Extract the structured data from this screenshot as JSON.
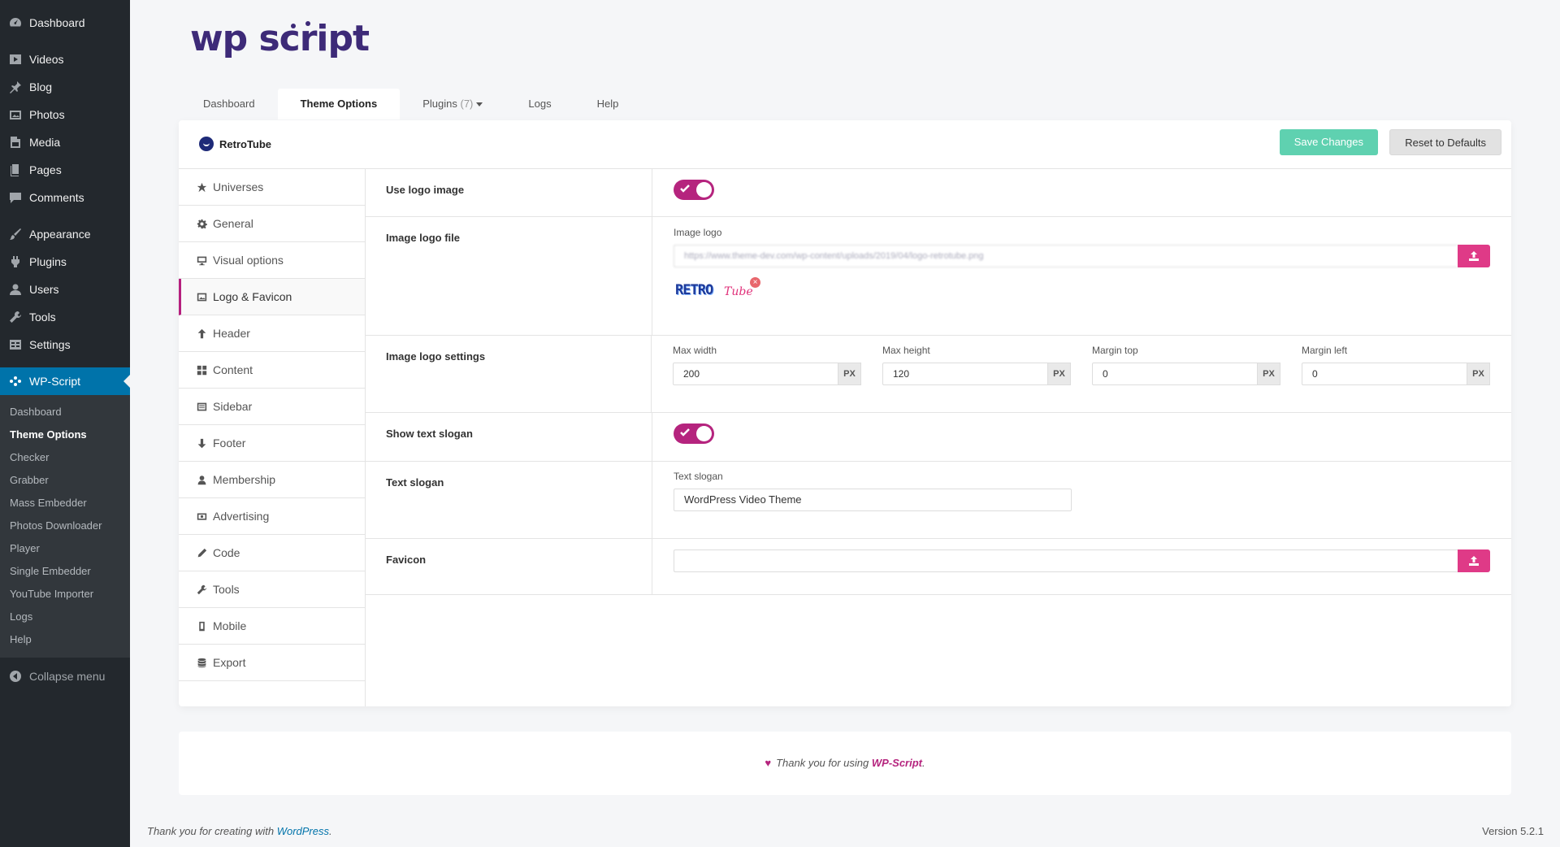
{
  "sidebar": {
    "items": [
      {
        "label": "Dashboard",
        "icon": "dashboard-icon"
      },
      {
        "label": "Videos",
        "icon": "video-icon"
      },
      {
        "label": "Blog",
        "icon": "pin-icon"
      },
      {
        "label": "Photos",
        "icon": "photos-icon"
      },
      {
        "label": "Media",
        "icon": "media-icon"
      },
      {
        "label": "Pages",
        "icon": "pages-icon"
      },
      {
        "label": "Comments",
        "icon": "comments-icon"
      },
      {
        "label": "Appearance",
        "icon": "brush-icon"
      },
      {
        "label": "Plugins",
        "icon": "plugin-icon"
      },
      {
        "label": "Users",
        "icon": "user-icon"
      },
      {
        "label": "Tools",
        "icon": "wrench-icon"
      },
      {
        "label": "Settings",
        "icon": "settings-icon"
      },
      {
        "label": "WP-Script",
        "icon": "wpscript-icon"
      }
    ],
    "submenu": [
      "Dashboard",
      "Theme Options",
      "Checker",
      "Grabber",
      "Mass Embedder",
      "Photos Downloader",
      "Player",
      "Single Embedder",
      "YouTube Importer",
      "Logs",
      "Help"
    ],
    "collapse": "Collapse menu"
  },
  "logo": "wp script",
  "tabs": [
    {
      "label": "Dashboard"
    },
    {
      "label": "Theme Options"
    },
    {
      "label": "Plugins",
      "count": "(7)"
    },
    {
      "label": "Logs"
    },
    {
      "label": "Help"
    }
  ],
  "panel": {
    "brand": "RetroTube",
    "save": "Save Changes",
    "reset": "Reset to Defaults"
  },
  "leftnav": [
    "Universes",
    "General",
    "Visual options",
    "Logo & Favicon",
    "Header",
    "Content",
    "Sidebar",
    "Footer",
    "Membership",
    "Advertising",
    "Code",
    "Tools",
    "Mobile",
    "Export"
  ],
  "options": {
    "use_logo": {
      "label": "Use logo image",
      "on": true
    },
    "logo_file": {
      "label": "Image logo file",
      "field": "Image logo",
      "url": "https://www.theme-dev.com/wp-content/uploads/2019/04/logo-retrotube.png",
      "preview_a": "RETRO",
      "preview_b": "Tube"
    },
    "logo_settings": {
      "label": "Image logo settings",
      "fields": [
        {
          "label": "Max width",
          "value": "200",
          "unit": "PX"
        },
        {
          "label": "Max height",
          "value": "120",
          "unit": "PX"
        },
        {
          "label": "Margin top",
          "value": "0",
          "unit": "PX"
        },
        {
          "label": "Margin left",
          "value": "0",
          "unit": "PX"
        }
      ]
    },
    "show_slogan": {
      "label": "Show text slogan",
      "on": true
    },
    "slogan": {
      "label": "Text slogan",
      "field": "Text slogan",
      "value": "WordPress Video Theme"
    },
    "favicon": {
      "label": "Favicon",
      "value": ""
    }
  },
  "footer": {
    "pre": "Thank you for using ",
    "brand": "WP-Script",
    "post": "."
  },
  "wpfooter": {
    "pre": "Thank you for creating with ",
    "link": "WordPress",
    "post": ".",
    "version": "Version 5.2.1"
  },
  "colors": {
    "accent": "#b5247e",
    "save": "#5fd1b0",
    "upload": "#df3a87",
    "admin_bar": "#23282d",
    "admin_current": "#0073aa"
  }
}
